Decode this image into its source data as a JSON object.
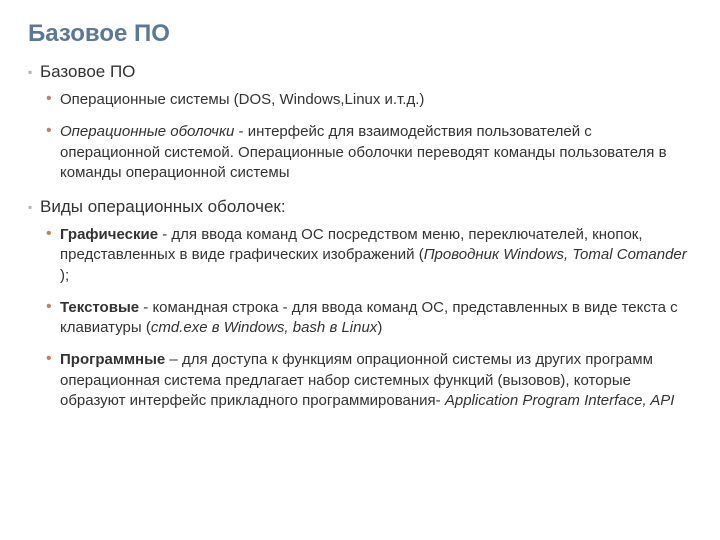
{
  "title": "Базовое ПО",
  "section1": {
    "heading": "Базовое  ПО",
    "item1": "Операционные системы (DOS, Windows,Linux и.т.д.)",
    "item2_italic": "Операционные оболочки",
    "item2_rest": " - интерфейс для взаимодействия пользователей с операционной системой. Операционные оболочки переводят команды пользователя в команды операционной системы"
  },
  "section2": {
    "heading": "Виды операционных оболочек:",
    "graph_bold": "Графические",
    "graph_text": " - для ввода команд ОС посредством меню, переключателей, кнопок, представленных в виде графических изображений (",
    "graph_italic": "Проводник Windows, Tomal Comander ",
    "graph_end": ");",
    "text_bold": "Текстовые",
    "text_text": " - командная строка - для ввода команд ОС, представленных в виде текста с клавиатуры (",
    "text_italic": "cmd.exe в Windows, bash в Linux",
    "text_end": ")",
    "prog_bold": "Программные",
    "prog_text": " – для доступа к функциям опрационной системы из других программ операционная система  предлагает набор системных функций (вызовов), которые образуют интерфейс прикладного программирования- ",
    "prog_italic": "Application Program Interface, API"
  }
}
